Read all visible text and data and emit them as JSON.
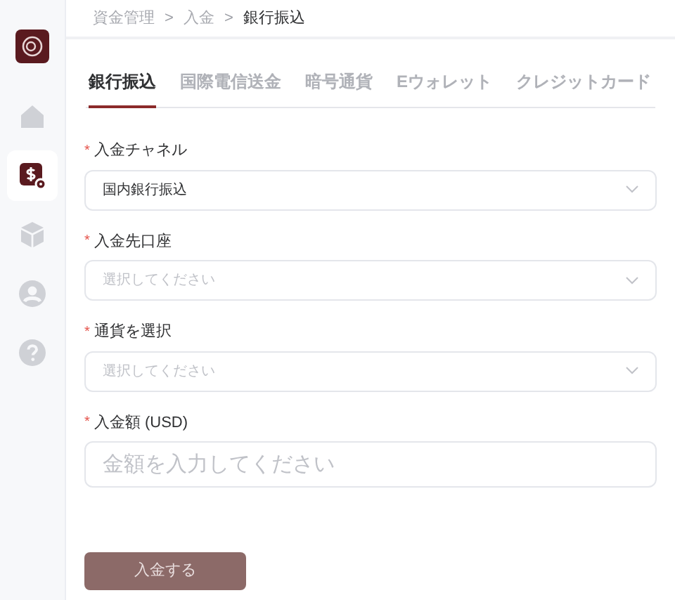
{
  "sidebar": {
    "items": [
      {
        "kind": "home",
        "selected": false
      },
      {
        "kind": "deposit",
        "selected": true
      },
      {
        "kind": "box",
        "selected": false
      },
      {
        "kind": "user",
        "selected": false
      },
      {
        "kind": "help",
        "selected": false
      }
    ]
  },
  "breadcrumb": [
    {
      "label": "資金管理",
      "current": false
    },
    {
      "label": "入金",
      "current": false
    },
    {
      "label": "銀行振込",
      "current": true
    }
  ],
  "separator": ">",
  "tabs": [
    {
      "label": "銀行振込",
      "selected": true
    },
    {
      "label": "国際電信送金",
      "selected": false
    },
    {
      "label": "暗号通貨",
      "selected": false
    },
    {
      "label": "Eウォレット",
      "selected": false
    },
    {
      "label": "クレジットカード",
      "selected": false
    }
  ],
  "fields": [
    {
      "kind": "select",
      "mark": "*",
      "label": "入金チャネル",
      "value": "国内銀行振込"
    },
    {
      "kind": "select",
      "mark": "*",
      "label": "入金先口座",
      "placeholder": "選択してください"
    },
    {
      "kind": "select",
      "mark": "*",
      "label": "通貨を選択",
      "placeholder": "選択してください"
    },
    {
      "kind": "input",
      "mark": "*",
      "label": "入金額 (USD)",
      "placeholder": "金額を入力してください"
    }
  ],
  "submit": {
    "label": "入金する",
    "disabled": true
  }
}
